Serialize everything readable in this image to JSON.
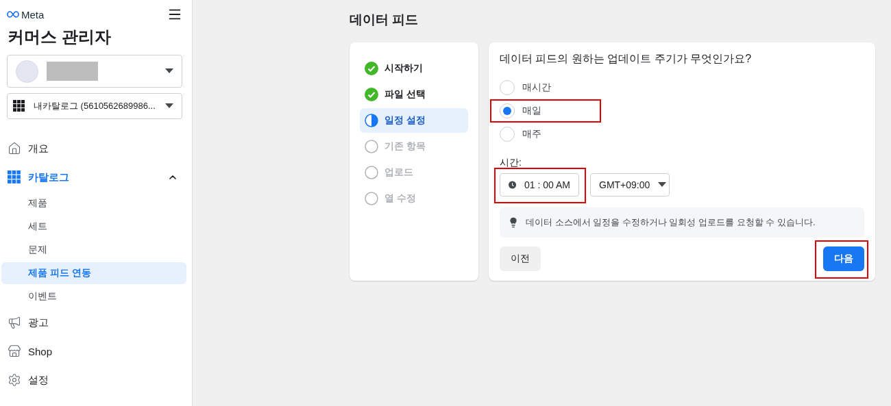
{
  "brand": {
    "logo_text": "Meta",
    "title": "커머스 관리자"
  },
  "account_selector": {
    "redacted": true
  },
  "catalog_selector": {
    "label": "내카탈로그 (5610562689986..."
  },
  "sidebar": {
    "items": [
      {
        "kind": "home",
        "label": "개요",
        "selected": false
      },
      {
        "kind": "grid",
        "label": "카탈로그",
        "selected": true,
        "expanded": true,
        "children": [
          {
            "label": "제품",
            "selected": false
          },
          {
            "label": "세트",
            "selected": false
          },
          {
            "label": "문제",
            "selected": false
          },
          {
            "label": "제품 피드 연동",
            "selected": true
          },
          {
            "label": "이벤트",
            "selected": false
          }
        ]
      },
      {
        "kind": "megaphone",
        "label": "광고",
        "selected": false
      },
      {
        "kind": "store",
        "label": "Shop",
        "selected": false
      },
      {
        "kind": "gear",
        "label": "설정",
        "selected": false
      }
    ]
  },
  "page_title": "데이터 피드",
  "steps": [
    {
      "label": "시작하기",
      "kind": "done",
      "selected": false
    },
    {
      "label": "파일 선택",
      "kind": "done",
      "selected": false
    },
    {
      "label": "일정 설정",
      "kind": "current",
      "selected": true
    },
    {
      "label": "기존 항목",
      "kind": "pending",
      "selected": false
    },
    {
      "label": "업로드",
      "kind": "pending",
      "selected": false
    },
    {
      "label": "열 수정",
      "kind": "pending",
      "selected": false
    }
  ],
  "form": {
    "question": "데이터 피드의 원하는 업데이트 주기가 무엇인가요?",
    "options": [
      {
        "label": "매시간",
        "selected": false,
        "highlighted": false
      },
      {
        "label": "매일",
        "selected": true,
        "highlighted": true
      },
      {
        "label": "매주",
        "selected": false,
        "highlighted": false
      }
    ],
    "time_label": "시간:",
    "time": {
      "value": "01 : 00 AM",
      "highlighted": true
    },
    "timezone": {
      "value": "GMT+09:00"
    },
    "tip": "데이터 소스에서 일정을 수정하거나 일회성 업로드를 요청할 수 있습니다.",
    "back_button": {
      "label": "이전"
    },
    "next_button": {
      "label": "다음",
      "highlighted": true
    }
  }
}
